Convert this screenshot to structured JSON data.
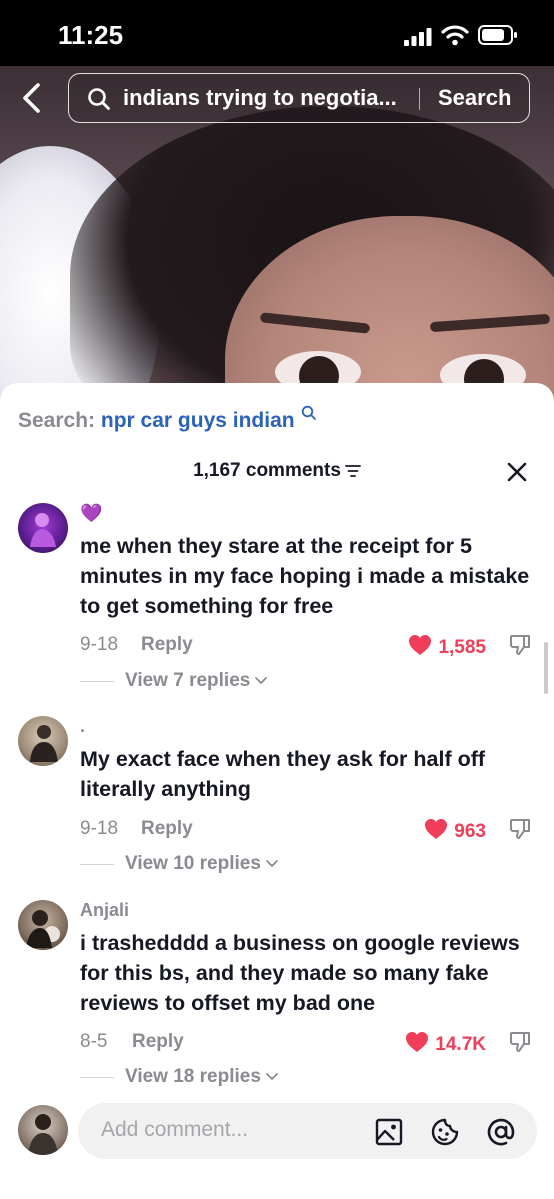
{
  "status_bar": {
    "time": "11:25"
  },
  "search": {
    "query": "indians trying to negotia...",
    "button_label": "Search"
  },
  "related_search": {
    "label": "Search:",
    "term": "npr car guys indian"
  },
  "comments_header": {
    "count": "1,167 comments"
  },
  "comments": [
    {
      "username": "💜",
      "text": "me when they stare at the receipt for 5 minutes in my face hoping i made a mistake to get something for free",
      "date": "9-18",
      "reply_label": "Reply",
      "likes": "1,585",
      "liked": true,
      "view_replies": "View 7 replies"
    },
    {
      "username": ".",
      "text": "My exact face when they ask for half off literally anything",
      "date": "9-18",
      "reply_label": "Reply",
      "likes": "963",
      "liked": true,
      "view_replies": "View 10 replies"
    },
    {
      "username": "Anjali",
      "text": "i trashedddd a business on google reviews for this bs, and they made so many fake reviews to offset my bad one",
      "date": "8-5",
      "reply_label": "Reply",
      "likes": "14.7K",
      "liked": true,
      "view_replies": "View 18 replies"
    }
  ],
  "comment_input": {
    "placeholder": "Add comment..."
  },
  "colors": {
    "like_red": "#ef3d5a",
    "link_blue": "#2c63b8",
    "muted_gray": "#8a8b91",
    "text_dark": "#161823"
  },
  "icons": [
    "back-icon",
    "search-icon",
    "sort-icon",
    "close-icon",
    "heart-icon",
    "dislike-icon",
    "chevron-down-icon",
    "image-icon",
    "emoji-icon",
    "mention-icon"
  ]
}
